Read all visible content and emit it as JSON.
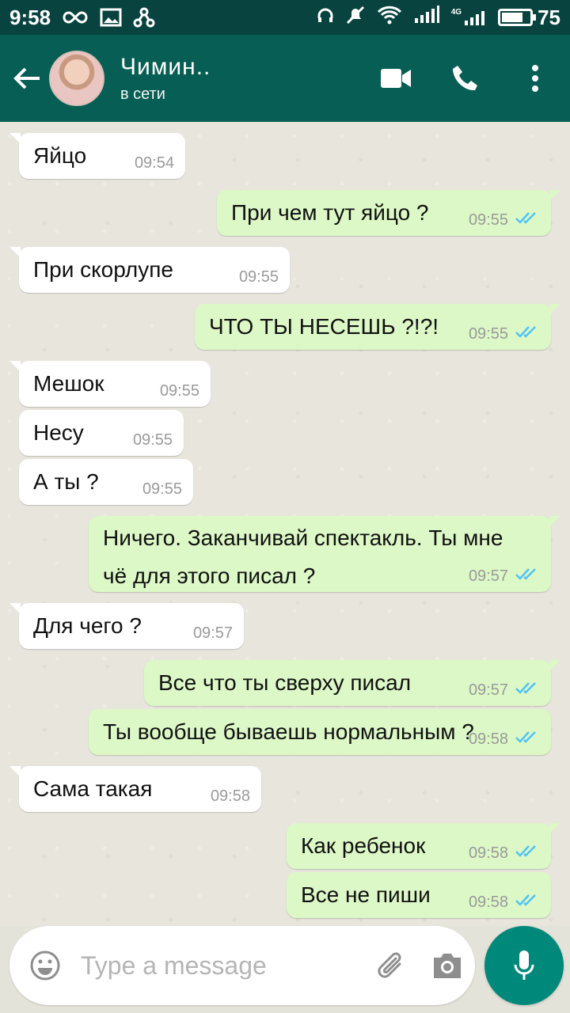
{
  "status_bar": {
    "time": "9:58",
    "network": "4G",
    "battery": "75"
  },
  "header": {
    "contact_name": "Чимин..",
    "contact_status": "в сети"
  },
  "messages": [
    {
      "dir": "in",
      "text": "Яйцо",
      "time": "09:54"
    },
    {
      "dir": "out",
      "text": "При чем тут яйцо ?",
      "time": "09:55"
    },
    {
      "dir": "in",
      "text": "При скорлупе",
      "time": "09:55"
    },
    {
      "dir": "out",
      "text": "ЧТО ТЫ НЕСЕШЬ ?!?!",
      "time": "09:55"
    },
    {
      "dir": "in",
      "text": "Мешок",
      "time": "09:55"
    },
    {
      "dir": "in",
      "text": "Несу",
      "time": "09:55"
    },
    {
      "dir": "in",
      "text": "А ты ?",
      "time": "09:55"
    },
    {
      "dir": "out",
      "text": "Ничего. Заканчивай спектакль. Ты мне чё для этого писал ?",
      "time": "09:57"
    },
    {
      "dir": "in",
      "text": "Для чего ?",
      "time": "09:57"
    },
    {
      "dir": "out",
      "text": "Все что ты сверху писал",
      "time": "09:57"
    },
    {
      "dir": "out",
      "text": "Ты вообще бываешь нормальным ?",
      "time": "09:58"
    },
    {
      "dir": "in",
      "text": "Сама такая",
      "time": "09:58"
    },
    {
      "dir": "out",
      "text": "Как ребенок",
      "time": "09:58"
    },
    {
      "dir": "out",
      "text": "Все не пиши",
      "time": "09:58"
    }
  ],
  "input": {
    "placeholder": "Type a message"
  },
  "colors": {
    "header": "#075e54",
    "status_bar": "#09433f",
    "outgoing": "#dcf8c6",
    "read_ticks": "#4fc3f7",
    "mic": "#00897b"
  }
}
